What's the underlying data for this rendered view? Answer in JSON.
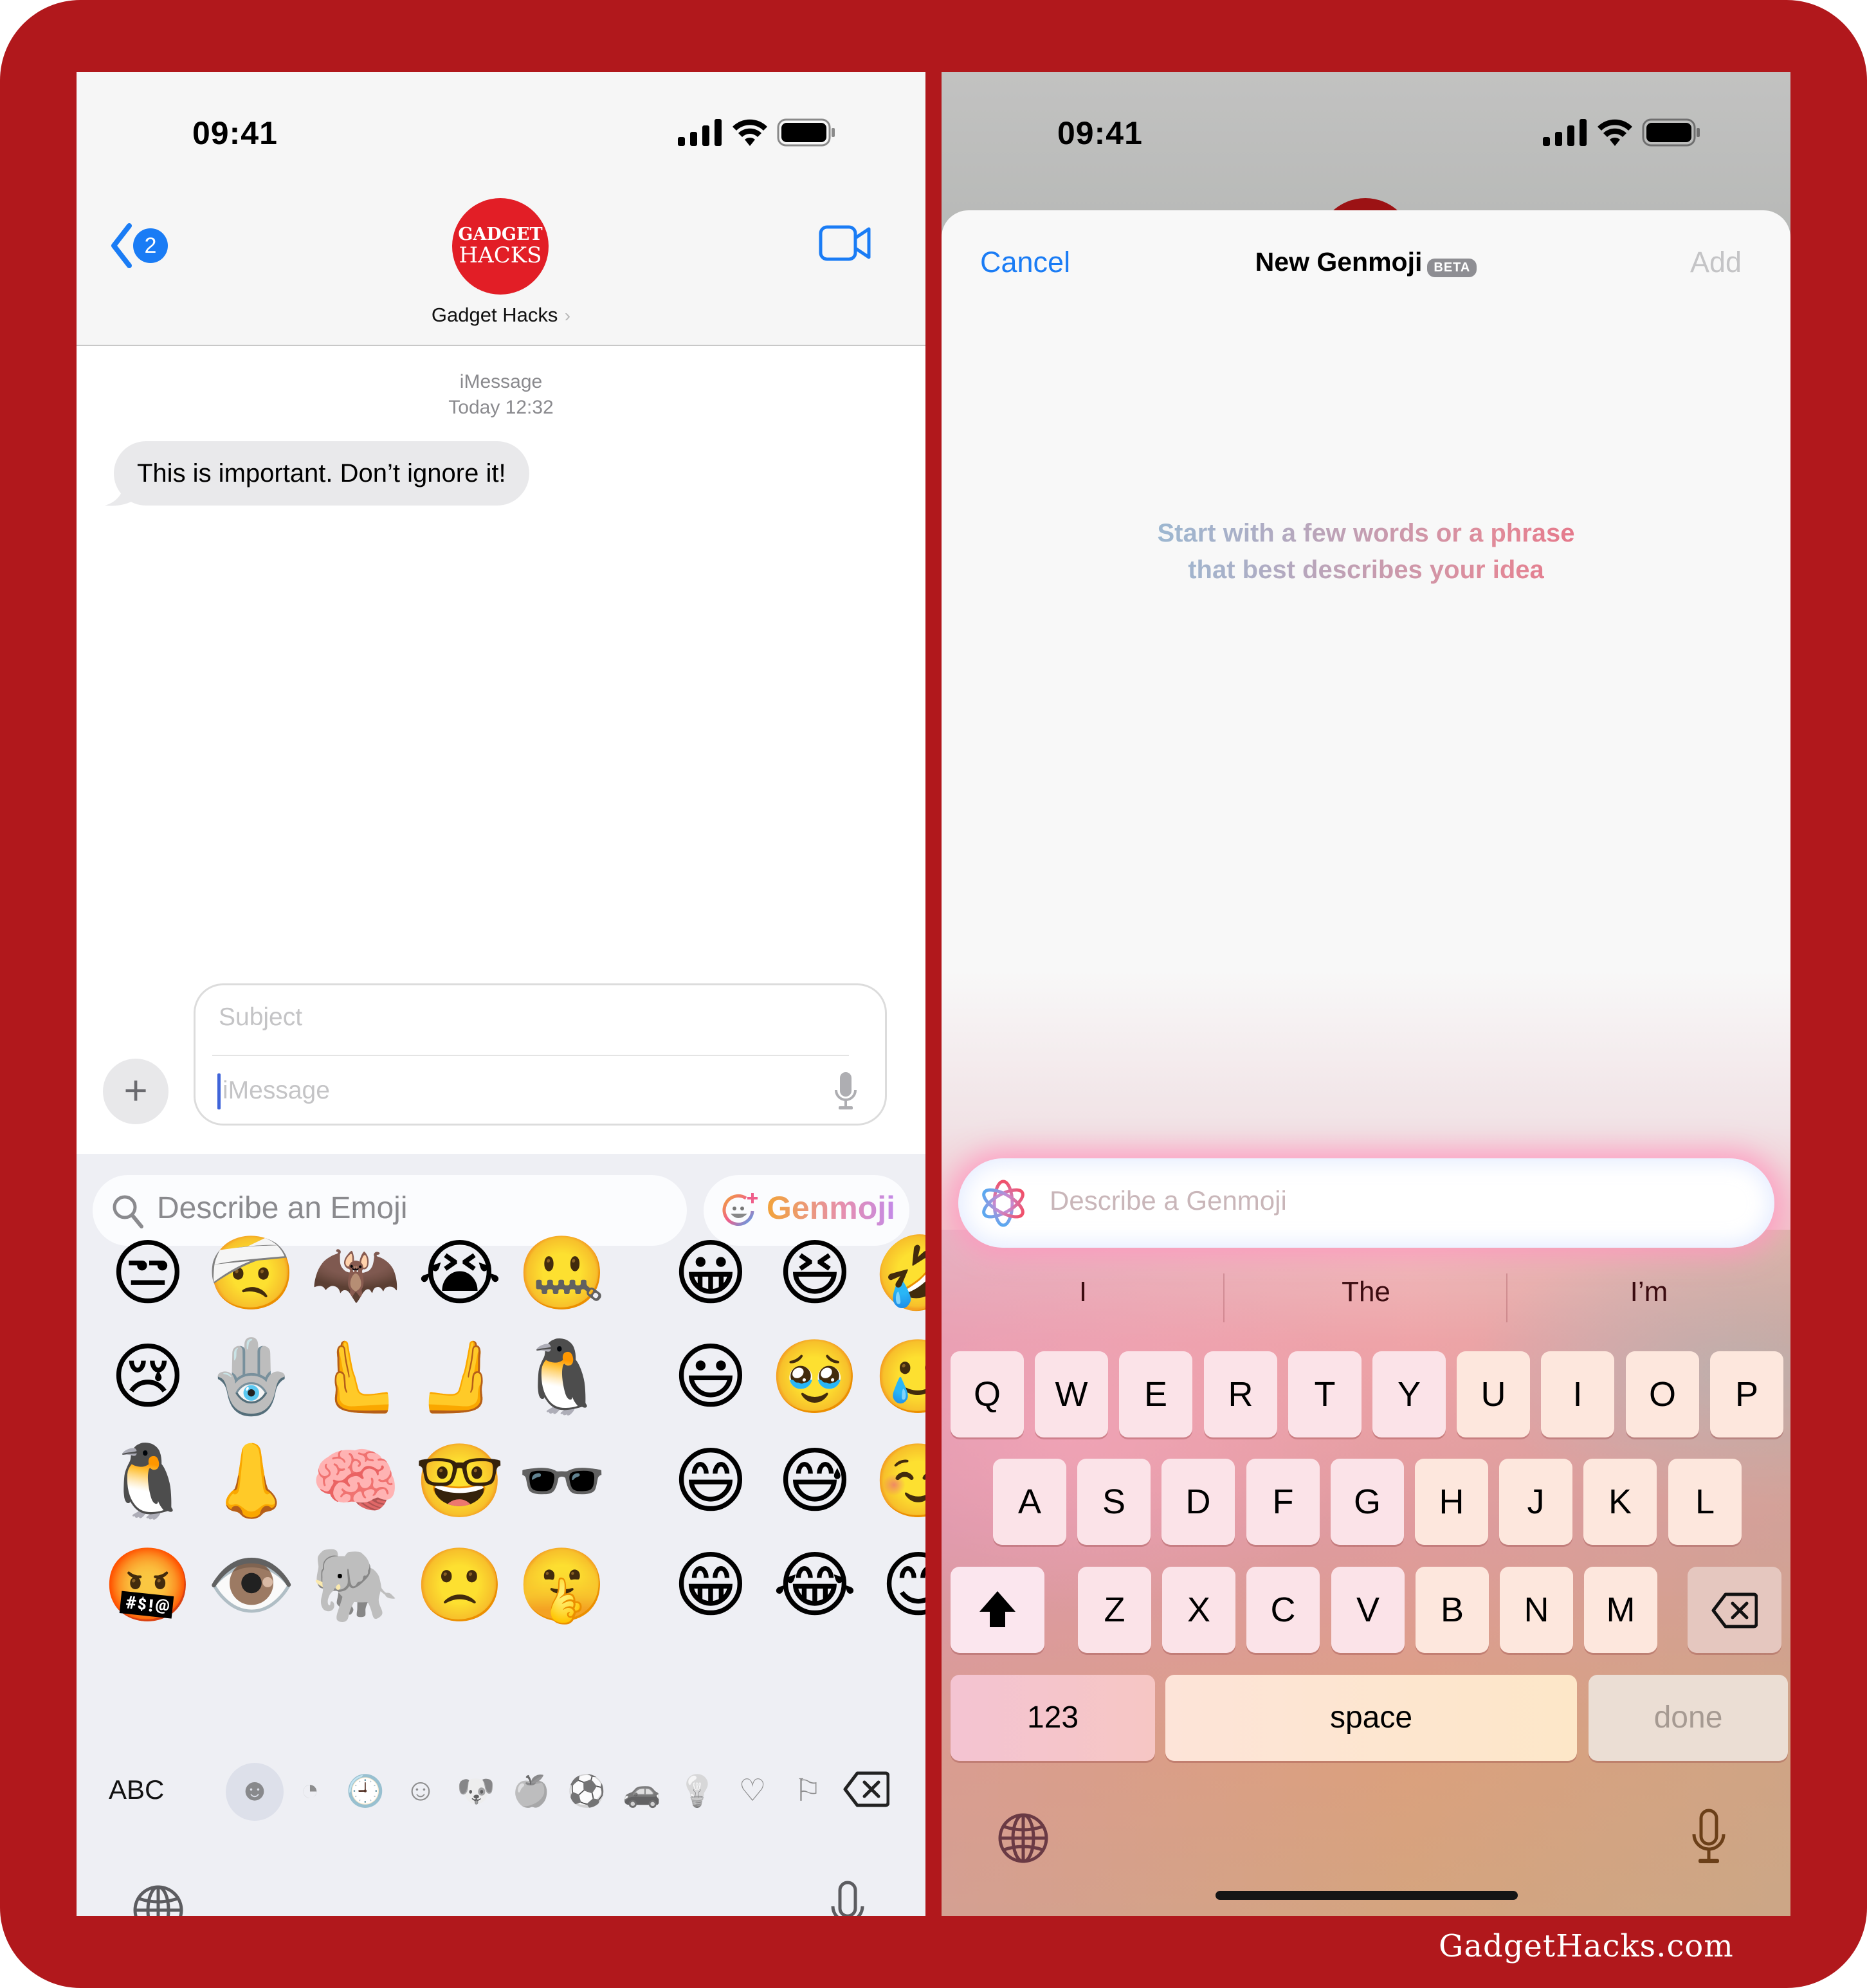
{
  "watermark": "GadgetHacks.com",
  "colors": {
    "frame": "#b1181c",
    "ios_blue": "#1a7cf5",
    "avatar_red": "#e21e26"
  },
  "left_screen": {
    "status_bar": {
      "time": "09:41",
      "icons": [
        "cellular-signal-icon",
        "wifi-icon",
        "battery-icon"
      ]
    },
    "header": {
      "back_badge_count": "2",
      "avatar": {
        "line1": "GADGET",
        "line2": "HACKS"
      },
      "contact_name": "Gadget Hacks",
      "contact_chevron": "›"
    },
    "conversation": {
      "service_label": "iMessage",
      "timestamp": "Today 12:32",
      "messages": [
        {
          "direction": "incoming",
          "text": "This is important. Don’t ignore it!"
        }
      ]
    },
    "compose": {
      "plus_label": "+",
      "subject_placeholder": "Subject",
      "message_placeholder": "iMessage"
    },
    "emoji_keyboard": {
      "search_placeholder": "Describe an Emoji",
      "genmoji_button": "Genmoji",
      "recent_grid": [
        [
          "😒",
          "🤕",
          "🦇",
          "😭",
          "🤐"
        ],
        [
          "😢",
          "🪬",
          "🫷",
          "🫸",
          "🐧"
        ],
        [
          "🐧",
          "👃",
          "🧠",
          "🤓",
          "🕶️"
        ],
        [
          "🤬",
          "👁️",
          "🐘",
          "🙁",
          "🤫"
        ]
      ],
      "smileys_grid": [
        [
          "😀",
          "😆",
          "🤣"
        ],
        [
          "😃",
          "🥹",
          "🥲"
        ],
        [
          "😄",
          "😅",
          "☺️"
        ],
        [
          "😁",
          "😂",
          "😊"
        ]
      ],
      "abc_label": "ABC",
      "categories": [
        {
          "name": "memoji",
          "glyph": "☻",
          "active": false
        },
        {
          "name": "stickers",
          "glyph": "◔",
          "active": false
        },
        {
          "name": "recents",
          "glyph": "🕘",
          "active": true
        },
        {
          "name": "smileys",
          "glyph": "☺",
          "active": false
        },
        {
          "name": "animals",
          "glyph": "🐶",
          "active": false
        },
        {
          "name": "food",
          "glyph": "🍏",
          "active": false
        },
        {
          "name": "activity",
          "glyph": "⚽",
          "active": false
        },
        {
          "name": "travel",
          "glyph": "🚗",
          "active": false
        },
        {
          "name": "objects",
          "glyph": "💡",
          "active": false
        },
        {
          "name": "symbols",
          "glyph": "♡",
          "active": false
        },
        {
          "name": "flags",
          "glyph": "⚐",
          "active": false
        }
      ]
    }
  },
  "right_screen": {
    "status_bar": {
      "time": "09:41",
      "icons": [
        "cellular-signal-icon",
        "wifi-icon",
        "battery-icon"
      ]
    },
    "sheet": {
      "cancel_label": "Cancel",
      "title": "New Genmoji",
      "badge": "BETA",
      "add_label": "Add",
      "prompt_line1": "Start with a few words or a phrase",
      "prompt_line2": "that best describes your idea",
      "input_placeholder": "Describe a Genmoji"
    },
    "keyboard": {
      "suggestions": [
        "I",
        "The",
        "I’m"
      ],
      "rows": [
        [
          "Q",
          "W",
          "E",
          "R",
          "T",
          "Y",
          "U",
          "I",
          "O",
          "P"
        ],
        [
          "A",
          "S",
          "D",
          "F",
          "G",
          "H",
          "J",
          "K",
          "L"
        ],
        [
          "Z",
          "X",
          "C",
          "V",
          "B",
          "N",
          "M"
        ]
      ],
      "numbers_label": "123",
      "space_label": "space",
      "done_label": "done"
    }
  }
}
